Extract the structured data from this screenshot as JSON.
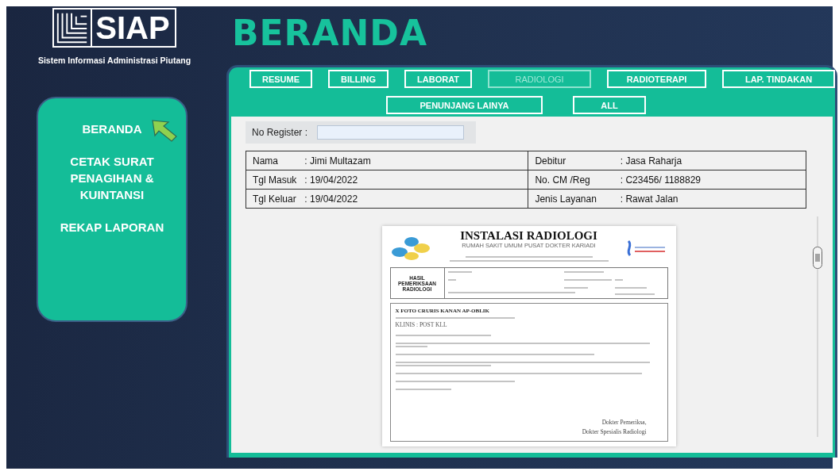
{
  "app": {
    "logo_text": "SIAP",
    "subtitle": "Sistem Informasi Administrasi Piutang"
  },
  "page_title": "BERANDA",
  "sidebar": {
    "items": [
      {
        "label": "BERANDA",
        "selected": true
      },
      {
        "label": "CETAK SURAT PENAGIHAN & KUINTANSI",
        "selected": false
      },
      {
        "label": "REKAP LAPORAN",
        "selected": false
      }
    ]
  },
  "tab_rows": [
    [
      {
        "label": "RESUME",
        "selected": false
      },
      {
        "label": "BILLING",
        "selected": false
      },
      {
        "label": "LABORAT",
        "selected": false
      },
      {
        "label": "RADIOLOGI",
        "selected": true
      },
      {
        "label": "RADIOTERAPI",
        "selected": false
      },
      {
        "label": "LAP. TINDAKAN",
        "selected": false
      }
    ],
    [
      {
        "label": "PENUNJANG LAINYA",
        "selected": false
      },
      {
        "label": "ALL",
        "selected": false
      }
    ]
  ],
  "register": {
    "label": "No Register :"
  },
  "patient_info": [
    [
      {
        "label": "Nama",
        "value": ": Jimi Multazam"
      },
      {
        "label": "Debitur",
        "value": ": Jasa Raharja"
      }
    ],
    [
      {
        "label": "Tgl Masuk",
        "value": ": 19/04/2022"
      },
      {
        "label": "No. CM /Reg",
        "value": ": C23456/ 1188829"
      }
    ],
    [
      {
        "label": "Tgl Keluar",
        "value": ": 19/04/2022"
      },
      {
        "label": "Jenis Layanan",
        "value": ": Rawat Jalan"
      }
    ]
  ],
  "document": {
    "title": "INSTALASI RADIOLOGI",
    "hospital": "RUMAH SAKIT UMUM PUSAT DOKTER KARIADI",
    "section_label": "HASIL PEMERIKSAAN RADIOLOGI",
    "exam_title": "X FOTO CRURIS KANAN AP-OBLIK",
    "clinical": "KLINIS : POST KLL",
    "signatures": [
      "Dokter Pemeriksa,",
      "Dokter Spesialis Radiologi"
    ]
  }
}
